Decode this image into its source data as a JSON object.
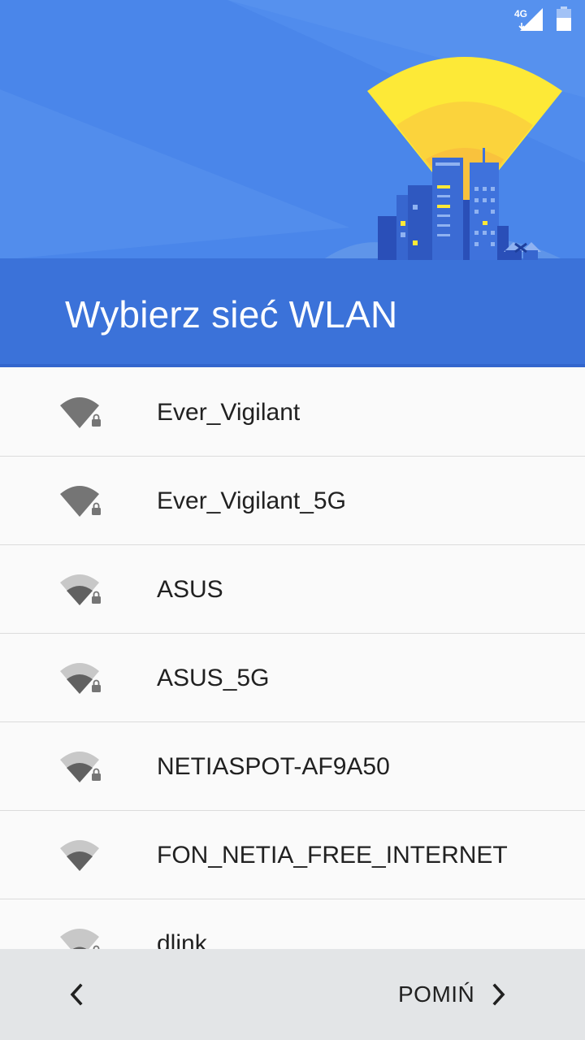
{
  "status_bar": {
    "network": "4G",
    "signal_icon": "cell-signal-icon",
    "battery_icon": "battery-icon"
  },
  "header": {
    "title": "Wybierz sieć WLAN",
    "illustration": "city-wifi-illustration"
  },
  "networks": [
    {
      "ssid": "Ever_Vigilant",
      "strength": "full",
      "secured": true
    },
    {
      "ssid": "Ever_Vigilant_5G",
      "strength": "full",
      "secured": true
    },
    {
      "ssid": "ASUS",
      "strength": "medium",
      "secured": true
    },
    {
      "ssid": "ASUS_5G",
      "strength": "medium",
      "secured": true
    },
    {
      "ssid": "NETIASPOT-AF9A50",
      "strength": "medium",
      "secured": true
    },
    {
      "ssid": "FON_NETIA_FREE_INTERNET",
      "strength": "medium",
      "secured": false
    },
    {
      "ssid": "dlink",
      "strength": "low",
      "secured": true
    }
  ],
  "footer": {
    "back_icon": "chevron-left-icon",
    "skip_label": "POMIŃ",
    "skip_icon": "chevron-right-icon"
  },
  "colors": {
    "header_blue": "#4a86ea",
    "header_dark": "#3a6fd6",
    "wifi_dark": "#757575",
    "wifi_light": "#c8c8c8",
    "footer_bg": "#e3e5e7"
  }
}
